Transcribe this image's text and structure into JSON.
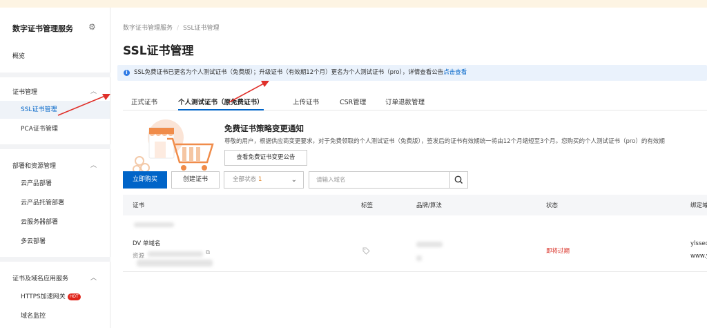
{
  "sidebar": {
    "title": "数字证书管理服务",
    "overview": "概览",
    "groups": [
      {
        "label": "证书管理",
        "items": [
          "SSL证书管理",
          "PCA证书管理"
        ]
      },
      {
        "label": "部署和资源管理",
        "items": [
          "云产品部署",
          "云产品托管部署",
          "云服务器部署",
          "多云部署"
        ]
      },
      {
        "label": "证书及域名应用服务",
        "items": [
          "HTTPS加速网关",
          "域名监控"
        ]
      }
    ],
    "hot_badge": "HOT"
  },
  "breadcrumb": [
    "数字证书管理服务",
    "SSL证书管理"
  ],
  "page_title": "SSL证书管理",
  "notice": {
    "text": "SSL免费证书已更名为个人测试证书（免费版）；升级证书（有效期12个月）更名为个人测试证书（pro），详情查看公告",
    "link": "点击查看"
  },
  "tabs": [
    "正式证书",
    "个人测试证书（原免费证书）",
    "上传证书",
    "CSR管理",
    "订单退款管理"
  ],
  "promo": {
    "title": "免费证书策略变更通知",
    "desc": "尊敬的用户，根据供应商变更要求，对于免费领取的个人测试证书（免费版），签发后的证书有效期统一将由12个月缩短至3个月。您购买的个人测试证书（pro）的有效期",
    "button": "查看免费证书变更公告"
  },
  "toolbar": {
    "buy": "立即购买",
    "create": "创建证书",
    "status_label": "全部状态",
    "status_count": "1",
    "search_placeholder": "请输入域名"
  },
  "table": {
    "headers": [
      "证书",
      "标签",
      "品牌/算法",
      "状态",
      "绑定域"
    ],
    "rows": [
      {
        "cert_type": "DV 单域名",
        "resource_prefix": "资源",
        "status": "即将过期",
        "domain1": "ylsseo",
        "domain2": "www.y"
      }
    ]
  },
  "colors": {
    "accent": "#0064c8",
    "warning": "#d93026",
    "arrow": "#e0302a"
  }
}
